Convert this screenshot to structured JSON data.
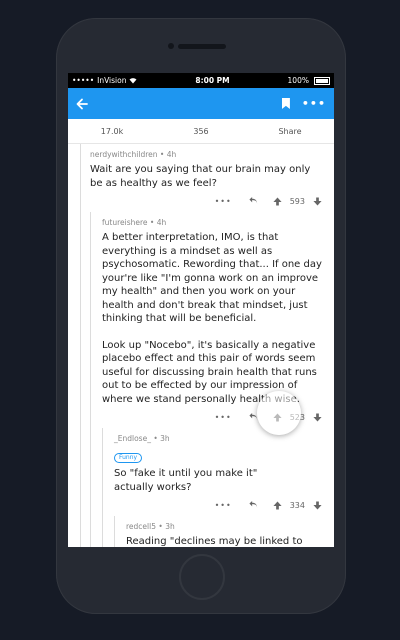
{
  "status_bar": {
    "signal": "•••••",
    "carrier": "InVision",
    "time": "8:00 PM",
    "battery": "100%"
  },
  "app_bar": {
    "back_icon": "arrow-left-icon",
    "bookmark_icon": "bookmark-icon",
    "more_icon": "more-horizontal-icon"
  },
  "post_stats": {
    "score": "17.0k",
    "comments": "356",
    "share_label": "Share"
  },
  "comments": [
    {
      "author": "nerdywithchildren",
      "age": "4h",
      "text": "Wait are you saying that our brain may only be as healthy as we feel?",
      "more": "•••",
      "score": "593"
    },
    {
      "author": "futureishere",
      "age": "4h",
      "text_p1": "A better interpretation, IMO, is that everything is a mindset as well as psychosomatic. Rewording that... If one day your're like \"I'm gonna work on an improve my health\" and then you work on your health and don't break that mindset, just thinking that will be beneficial.",
      "text_p2": "Look up \"Nocebo\", it's basically a negative placebo effect and this pair of words seem useful for discussing brain health that runs out to be effected by our impression of where we stand personally health wise.",
      "more": "•••",
      "score": "523"
    },
    {
      "author": "_Endlose_",
      "age": "3h",
      "flair": "Funny",
      "text": "So \"fake it until you make it\" actually works?",
      "more": "•••",
      "score": "334"
    },
    {
      "author": "redcell5",
      "age": "3h",
      "text": "Reading \"declines may be linked to compromised cognitive emotional"
    }
  ],
  "colors": {
    "accent": "#1e96f0",
    "status_bar": "#000000",
    "background": "#161b26",
    "phone_body": "#262a33"
  }
}
